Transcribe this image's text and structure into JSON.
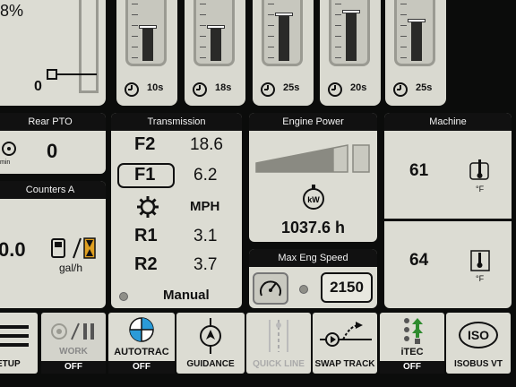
{
  "top_left": {
    "percent": "8%",
    "zero": "0"
  },
  "valves": [
    {
      "timer": "10s",
      "level": 0.55
    },
    {
      "timer": "18s",
      "level": 0.55
    },
    {
      "timer": "25s",
      "level": 0.75
    },
    {
      "timer": "20s",
      "level": 0.8
    },
    {
      "timer": "25s",
      "level": 0.65
    }
  ],
  "rear_pto": {
    "title": "Rear PTO",
    "value": "0",
    "unit": "min"
  },
  "counters": {
    "title": "Counters A",
    "value": "0.0",
    "unit": "gal/h"
  },
  "transmission": {
    "title": "Transmission",
    "rows": [
      {
        "label": "F2",
        "value": "18.6"
      },
      {
        "label": "F1",
        "value": "6.2"
      },
      {
        "label": "",
        "value": "MPH"
      },
      {
        "label": "R1",
        "value": "3.1"
      },
      {
        "label": "R2",
        "value": "3.7"
      }
    ],
    "mode": "Manual"
  },
  "engine_power": {
    "title": "Engine Power",
    "hours": "1037.6 h",
    "level": 0.85
  },
  "max_eng_speed": {
    "title": "Max Eng Speed",
    "value": "2150"
  },
  "machine": {
    "title": "Machine",
    "coolant_value": "61",
    "coolant_unit": "°F",
    "hyd_value": "64",
    "hyd_unit": "°F"
  },
  "toolbar": {
    "setup": "ETUP",
    "work": "WORK",
    "work_status": "OFF",
    "autotrac": "AUTOTRAC",
    "autotrac_status": "OFF",
    "guidance": "GUIDANCE",
    "quick_line": "QUICK LINE",
    "swap_track": "SWAP TRACK",
    "itec": "iTEC",
    "itec_status": "OFF",
    "isobus": "ISOBUS VT",
    "iso_logo": "ISO"
  }
}
